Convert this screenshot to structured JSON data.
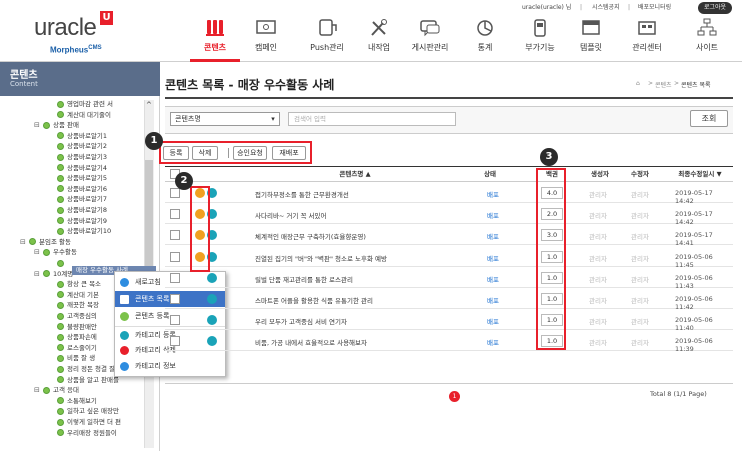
{
  "header": {
    "logo_text": "uracle",
    "logo_mark": "U",
    "logo_sub_brand": "Morpheus",
    "logo_sub_suffix": "CMS",
    "user": "uracle(uracle) 님",
    "util_links": [
      "시스템공지",
      "배포모니터링"
    ],
    "logout_label": "로그아웃",
    "nav": [
      {
        "label": "콘텐츠",
        "icon": "contents-icon",
        "active": true
      },
      {
        "label": "캠페인",
        "icon": "campaign-icon",
        "active": false
      },
      {
        "label": "Push관리",
        "icon": "push-icon",
        "active": false
      },
      {
        "label": "내작업",
        "icon": "tools-icon",
        "active": false
      },
      {
        "label": "게시판관리",
        "icon": "board-icon",
        "active": false
      },
      {
        "label": "통계",
        "icon": "stats-icon",
        "active": false
      },
      {
        "label": "부가기능",
        "icon": "addon-icon",
        "active": false
      },
      {
        "label": "템플릿",
        "icon": "template-icon",
        "active": false
      },
      {
        "label": "관리센터",
        "icon": "admin-icon",
        "active": false
      },
      {
        "label": "사이트",
        "icon": "site-icon",
        "active": false
      }
    ],
    "accent_color": "#e8202b"
  },
  "sidebar": {
    "title": "콘텐츠",
    "subtitle": "Content",
    "tree": [
      {
        "label": "영업마감 관련 서",
        "indent": 3,
        "pm": ""
      },
      {
        "label": "계산대 대기줄이 ",
        "indent": 3,
        "pm": ""
      },
      {
        "label": "상품 판매",
        "indent": 2,
        "pm": "⊟"
      },
      {
        "label": "상품바로알기1",
        "indent": 3,
        "pm": ""
      },
      {
        "label": "상품바로알기2",
        "indent": 3,
        "pm": ""
      },
      {
        "label": "상품바로알기3",
        "indent": 3,
        "pm": ""
      },
      {
        "label": "상품바로알기4",
        "indent": 3,
        "pm": ""
      },
      {
        "label": "상품바로알기5",
        "indent": 3,
        "pm": ""
      },
      {
        "label": "상품바로알기6",
        "indent": 3,
        "pm": ""
      },
      {
        "label": "상품바로알기7",
        "indent": 3,
        "pm": ""
      },
      {
        "label": "상품바로알기8",
        "indent": 3,
        "pm": ""
      },
      {
        "label": "상품바로알기9",
        "indent": 3,
        "pm": ""
      },
      {
        "label": "상품바로알기10",
        "indent": 3,
        "pm": ""
      },
      {
        "label": "분임조 활동",
        "indent": 1,
        "pm": "⊟"
      },
      {
        "label": "우수활동",
        "indent": 2,
        "pm": "⊟"
      },
      {
        "label": "",
        "indent": 3,
        "pm": ""
      },
      {
        "label": "10계명",
        "indent": 2,
        "pm": "⊟"
      },
      {
        "label": "항상 큰 목소",
        "indent": 3,
        "pm": ""
      },
      {
        "label": "계산대 기본",
        "indent": 3,
        "pm": ""
      },
      {
        "label": "깨끗한 복장",
        "indent": 3,
        "pm": ""
      },
      {
        "label": "고객중심의",
        "indent": 3,
        "pm": ""
      },
      {
        "label": "불량판매안",
        "indent": 3,
        "pm": ""
      },
      {
        "label": "상품파손에",
        "indent": 3,
        "pm": ""
      },
      {
        "label": "로스줄이기",
        "indent": 3,
        "pm": ""
      },
      {
        "label": "비품 잘 생",
        "indent": 3,
        "pm": ""
      },
      {
        "label": "정리 정돈 청결 잘하",
        "indent": 3,
        "pm": ""
      },
      {
        "label": "상품을 알고 판매를",
        "indent": 3,
        "pm": ""
      },
      {
        "label": "고객 응대",
        "indent": 2,
        "pm": "⊟"
      },
      {
        "label": "소통해보기",
        "indent": 3,
        "pm": ""
      },
      {
        "label": "일하고 싶은 매장만",
        "indent": 3,
        "pm": ""
      },
      {
        "label": "이렇게 일하면 더 편",
        "indent": 3,
        "pm": ""
      },
      {
        "label": "우리매장 정원들이 ",
        "indent": 3,
        "pm": ""
      }
    ],
    "selected_node": "매장 우수활동 사례"
  },
  "context_menu": {
    "items": [
      {
        "label": "새로고침",
        "color": "#2e8de0"
      },
      {
        "label": "콘텐츠 목록",
        "color": "#ffffff"
      },
      {
        "label": "콘텐츠 등록",
        "color": "#7cc24a"
      },
      {
        "label": "카테고리 등록",
        "color": "#1aa3b8"
      },
      {
        "label": "카테고리 삭제",
        "color": "#e8202b"
      },
      {
        "label": "카테고리 정보",
        "color": "#2e8de0"
      }
    ],
    "highlight_index": 1
  },
  "main": {
    "title": "콘텐츠 목록 - 매장 우수활동 사례",
    "breadcrumb": [
      "⌂",
      ">",
      "콘텐츠",
      ">",
      "콘텐츠 목록"
    ],
    "search": {
      "select_value": "콘텐츠명",
      "input_placeholder": "검색어 입력",
      "button": "조회"
    },
    "toolbar": {
      "register": "등록",
      "delete": "삭제",
      "approve": "승인요청",
      "redeploy": "재배포"
    },
    "table": {
      "headers": [
        "콘텐츠명 ▲",
        "상태",
        "백권",
        "생성자",
        "수정자",
        "최종수정일시 ▼"
      ],
      "rows": [
        {
          "name": "접기하부정소를 통한 근무환경개선",
          "status": "배포",
          "priority": "4.0",
          "creator": "관리자",
          "modifier": "관리자",
          "date": "2019-05-17 14:42"
        },
        {
          "name": "사다리바~ 거기 꼭 서있어",
          "status": "배포",
          "priority": "2.0",
          "creator": "관리자",
          "modifier": "관리자",
          "date": "2019-05-17 14:42"
        },
        {
          "name": "체계적인 매장근무 구축하기(효율향운영)",
          "status": "배포",
          "priority": "3.0",
          "creator": "관리자",
          "modifier": "관리자",
          "date": "2019-05-17 14:41"
        },
        {
          "name": "진열된 집기의 \"버\"와 \"벽판\" 청소로 노후화 예방",
          "status": "배포",
          "priority": "1.0",
          "creator": "관리자",
          "modifier": "관리자",
          "date": "2019-05-06 11:45"
        },
        {
          "name": "릴벌 단품 재고관리를 통한 로스관리",
          "status": "배포",
          "priority": "1.0",
          "creator": "관리자",
          "modifier": "관리자",
          "date": "2019-05-06 11:43"
        },
        {
          "name": "스마트폰 어플을 활용한 식품 유통기한 관리",
          "status": "배포",
          "priority": "1.0",
          "creator": "관리자",
          "modifier": "관리자",
          "date": "2019-05-06 11:42"
        },
        {
          "name": "우리 모두가 고객중심 서비 연기자",
          "status": "배포",
          "priority": "1.0",
          "creator": "관리자",
          "modifier": "관리자",
          "date": "2019-05-06 11:40"
        },
        {
          "name": "비품, 가공 내에서 효율적으로 사용해보자",
          "status": "배포",
          "priority": "1.0",
          "creator": "관리자",
          "modifier": "관리자",
          "date": "2019-05-06 11:39"
        }
      ]
    },
    "total": "Total 8 (1/1 Page)",
    "page": "1"
  },
  "callouts": [
    "1",
    "2",
    "3"
  ]
}
